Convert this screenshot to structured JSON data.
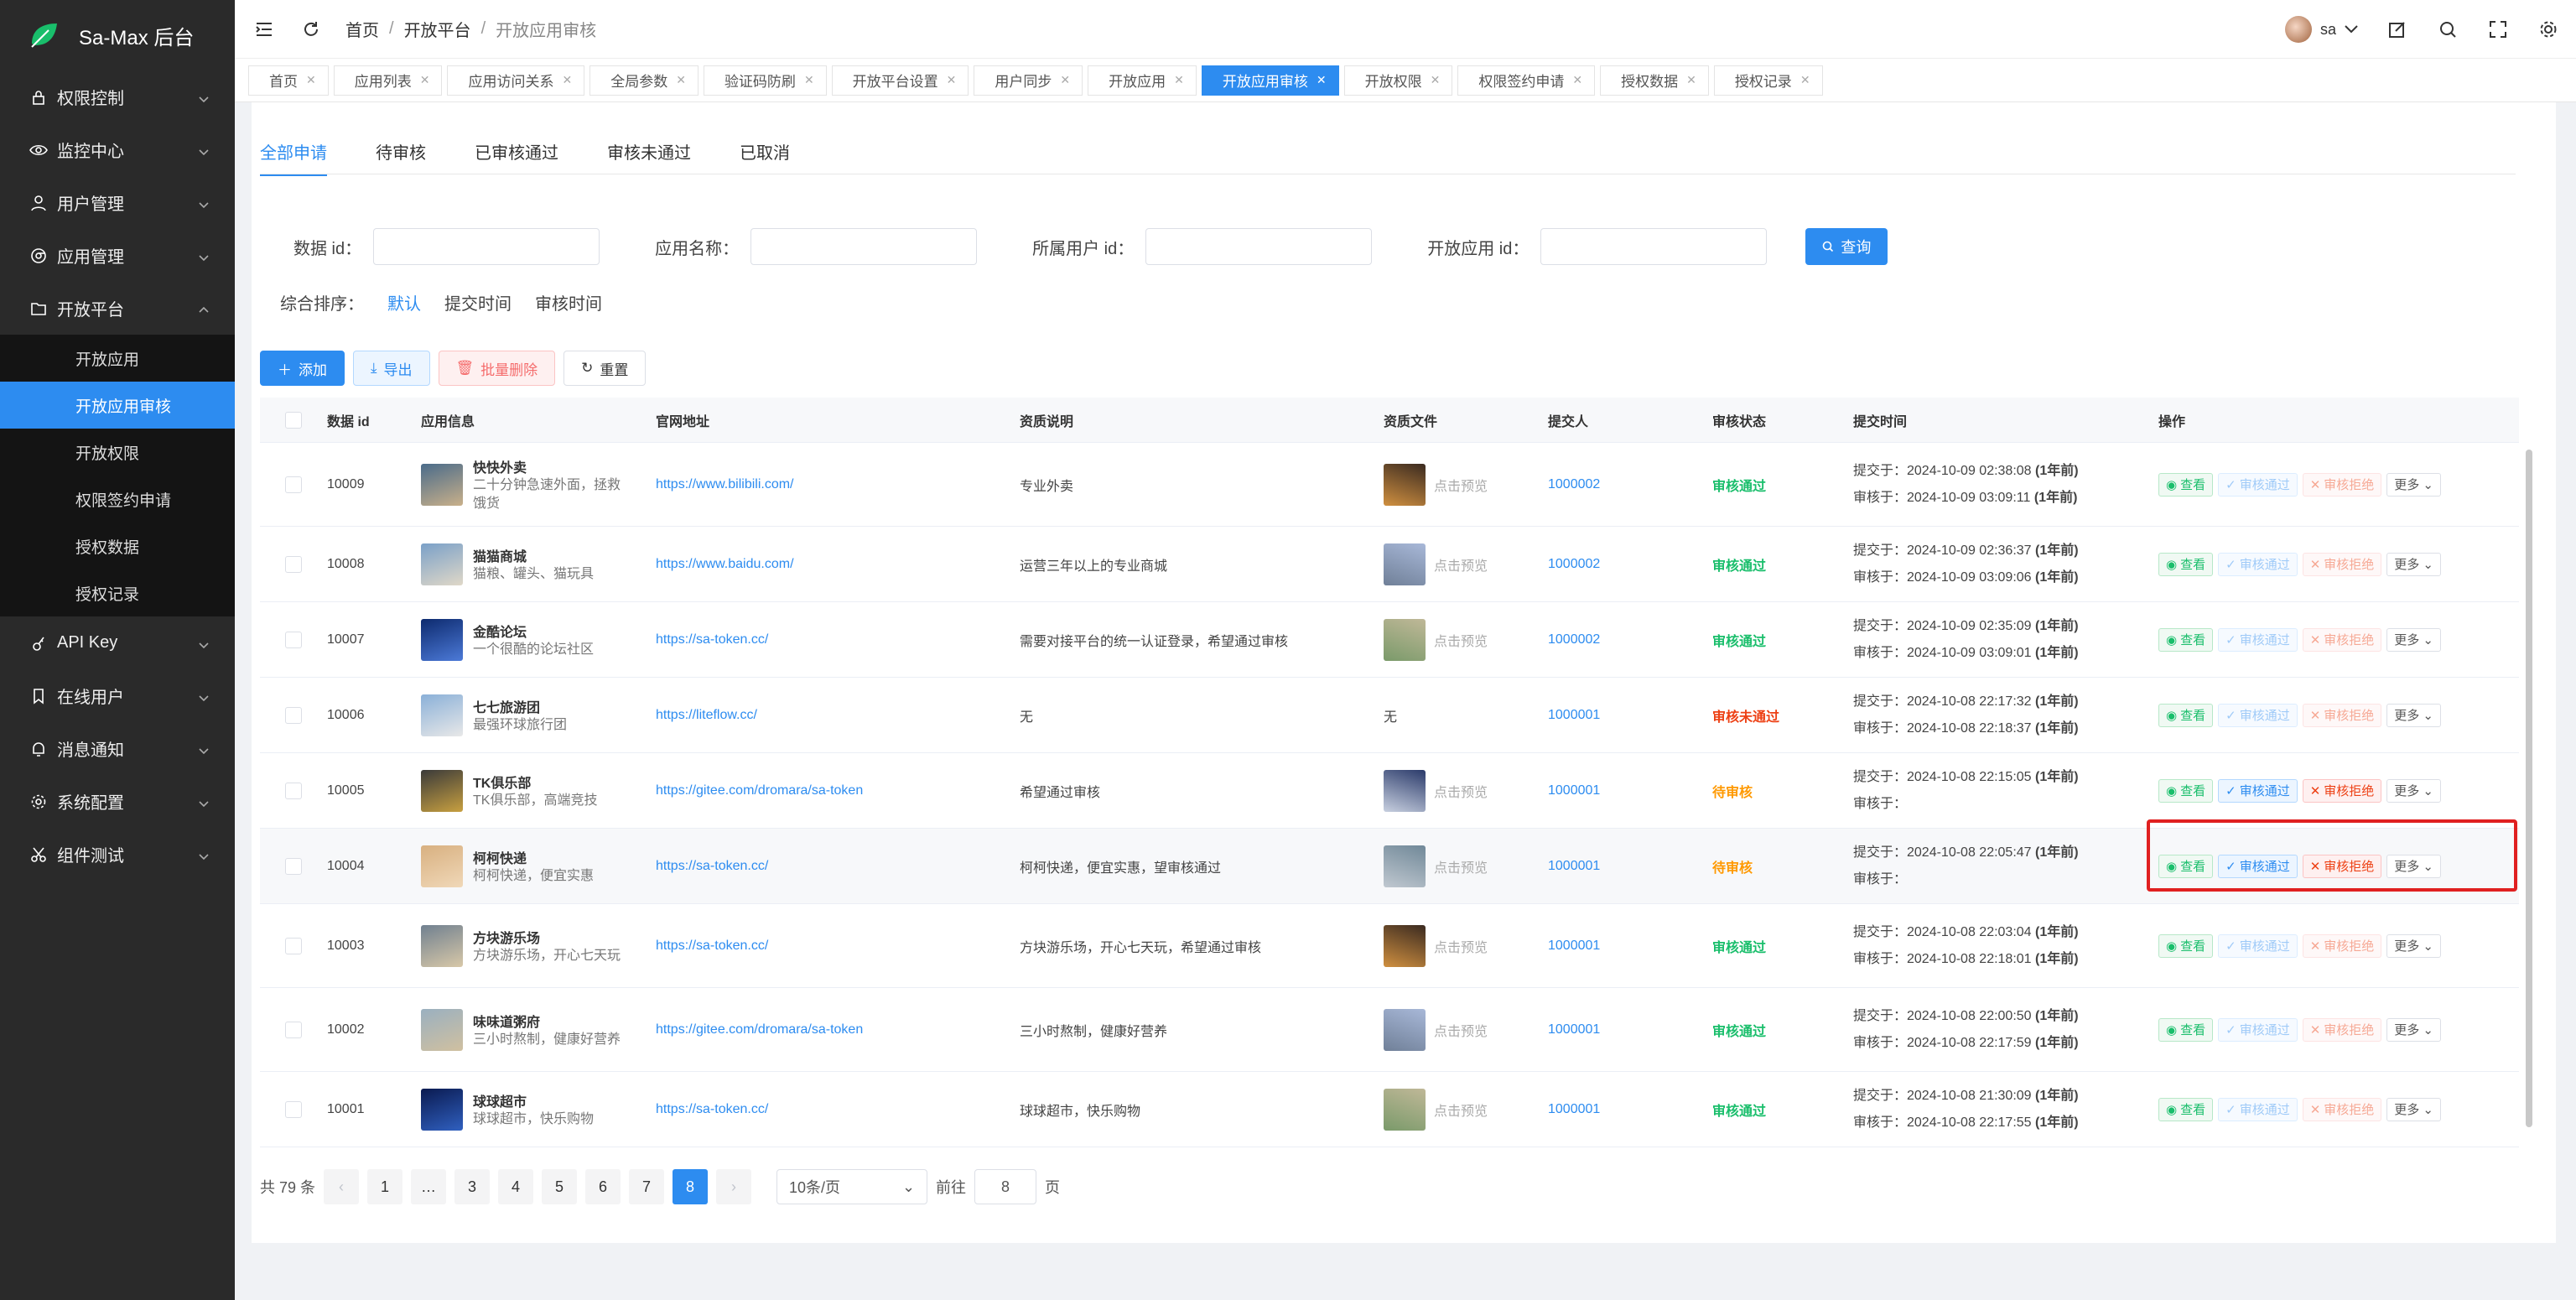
{
  "app": {
    "title": "Sa-Max 后台"
  },
  "sidebar": {
    "items": [
      {
        "label": "权限控制",
        "icon": "lock-icon"
      },
      {
        "label": "监控中心",
        "icon": "eye-icon"
      },
      {
        "label": "用户管理",
        "icon": "user-icon"
      },
      {
        "label": "应用管理",
        "icon": "chrome-icon"
      },
      {
        "label": "开放平台",
        "icon": "folder-icon"
      }
    ],
    "open_sub": [
      {
        "label": "开放应用",
        "active": false
      },
      {
        "label": "开放应用审核",
        "active": true
      },
      {
        "label": "开放权限",
        "active": false
      },
      {
        "label": "权限签约申请",
        "active": false
      },
      {
        "label": "授权数据",
        "active": false
      },
      {
        "label": "授权记录",
        "active": false
      }
    ],
    "items_after": [
      {
        "label": "API Key",
        "icon": "key-icon"
      },
      {
        "label": "在线用户",
        "icon": "bookmark-icon"
      },
      {
        "label": "消息通知",
        "icon": "bell-icon"
      },
      {
        "label": "系统配置",
        "icon": "gear-icon"
      },
      {
        "label": "组件测试",
        "icon": "scissors-icon"
      }
    ]
  },
  "header": {
    "breadcrumb": [
      "首页",
      "开放平台",
      "开放应用审核"
    ],
    "user": "sa"
  },
  "tabs": [
    "首页",
    "应用列表",
    "应用访问关系",
    "全局参数",
    "验证码防刷",
    "开放平台设置",
    "用户同步",
    "开放应用",
    "开放应用审核",
    "开放权限",
    "权限签约申请",
    "授权数据",
    "授权记录"
  ],
  "active_tab": "开放应用审核",
  "subtabs": [
    "全部申请",
    "待审核",
    "已审核通过",
    "审核未通过",
    "已取消"
  ],
  "filters": {
    "id_label": "数据 id：",
    "name_label": "应用名称：",
    "user_label": "所属用户 id：",
    "app_label": "开放应用 id：",
    "query_btn": "查询"
  },
  "sort": {
    "label": "综合排序：",
    "options": [
      "默认",
      "提交时间",
      "审核时间"
    ]
  },
  "actions": {
    "add": "添加",
    "export": "导出",
    "batch_delete": "批量删除",
    "reset": "重置"
  },
  "table": {
    "headers": [
      "数据 id",
      "应用信息",
      "官网地址",
      "资质说明",
      "资质文件",
      "提交人",
      "审核状态",
      "提交时间",
      "操作"
    ],
    "rows": [
      {
        "id": "10009",
        "name": "快快外卖",
        "desc": "二十分钟急速外面，拯救饿货",
        "url": "https://www.bilibili.com/",
        "qual": "专业外卖",
        "file": "点击预览",
        "user": "1000002",
        "status": "审核通过",
        "submit": "2024-10-09 02:38:08",
        "submit_ago": "(1年前)",
        "audit": "2024-10-09 03:09:11",
        "audit_ago": "(1年前)"
      },
      {
        "id": "10008",
        "name": "猫猫商城",
        "desc": "猫粮、罐头、猫玩具",
        "url": "https://www.baidu.com/",
        "qual": "运营三年以上的专业商城",
        "file": "点击预览",
        "user": "1000002",
        "status": "审核通过",
        "submit": "2024-10-09 02:36:37",
        "submit_ago": "(1年前)",
        "audit": "2024-10-09 03:09:06",
        "audit_ago": "(1年前)"
      },
      {
        "id": "10007",
        "name": "金酷论坛",
        "desc": "一个很酷的论坛社区",
        "url": "https://sa-token.cc/",
        "qual": "需要对接平台的统一认证登录，希望通过审核",
        "file": "点击预览",
        "user": "1000002",
        "status": "审核通过",
        "submit": "2024-10-09 02:35:09",
        "submit_ago": "(1年前)",
        "audit": "2024-10-09 03:09:01",
        "audit_ago": "(1年前)"
      },
      {
        "id": "10006",
        "name": "七七旅游团",
        "desc": "最强环球旅行团",
        "url": "https://liteflow.cc/",
        "qual": "无",
        "file": "无",
        "user": "1000001",
        "status": "审核未通过",
        "submit": "2024-10-08 22:17:32",
        "submit_ago": "(1年前)",
        "audit": "2024-10-08 22:18:37",
        "audit_ago": "(1年前)"
      },
      {
        "id": "10005",
        "name": "TK俱乐部",
        "desc": "TK俱乐部，高端竞技",
        "url": "https://gitee.com/dromara/sa-token",
        "qual": "希望通过审核",
        "file": "点击预览",
        "user": "1000001",
        "status": "待审核",
        "submit": "2024-10-08 22:15:05",
        "submit_ago": "(1年前)",
        "audit": "",
        "audit_ago": ""
      },
      {
        "id": "10004",
        "name": "柯柯快递",
        "desc": "柯柯快递，便宜实惠",
        "url": "https://sa-token.cc/",
        "qual": "柯柯快递，便宜实惠，望审核通过",
        "file": "点击预览",
        "user": "1000001",
        "status": "待审核",
        "submit": "2024-10-08 22:05:47",
        "submit_ago": "(1年前)",
        "audit": "",
        "audit_ago": ""
      },
      {
        "id": "10003",
        "name": "方块游乐场",
        "desc": "方块游乐场，开心七天玩",
        "url": "https://sa-token.cc/",
        "qual": "方块游乐场，开心七天玩，希望通过审核",
        "file": "点击预览",
        "user": "1000001",
        "status": "审核通过",
        "submit": "2024-10-08 22:03:04",
        "submit_ago": "(1年前)",
        "audit": "2024-10-08 22:18:01",
        "audit_ago": "(1年前)"
      },
      {
        "id": "10002",
        "name": "味味道粥府",
        "desc": "三小时熬制，健康好营养",
        "url": "https://gitee.com/dromara/sa-token",
        "qual": "三小时熬制，健康好营养",
        "file": "点击预览",
        "user": "1000001",
        "status": "审核通过",
        "submit": "2024-10-08 22:00:50",
        "submit_ago": "(1年前)",
        "audit": "2024-10-08 22:17:59",
        "audit_ago": "(1年前)"
      },
      {
        "id": "10001",
        "name": "球球超市",
        "desc": "球球超市，快乐购物",
        "url": "https://sa-token.cc/",
        "qual": "球球超市，快乐购物",
        "file": "点击预览",
        "user": "1000001",
        "status": "审核通过",
        "submit": "2024-10-08 21:30:09",
        "submit_ago": "(1年前)",
        "audit": "2024-10-08 22:17:55",
        "audit_ago": "(1年前)"
      }
    ],
    "submit_prefix": "提交于：",
    "audit_prefix": "审核于：",
    "op_view": "查看",
    "op_pass": "审核通过",
    "op_reject": "审核拒绝",
    "op_more": "更多"
  },
  "pager": {
    "total": "共 79 条",
    "pages": [
      "1",
      "…",
      "3",
      "4",
      "5",
      "6",
      "7",
      "8"
    ],
    "current": "8",
    "size": "10条/页",
    "goto_label": "前往",
    "goto_value": "8",
    "page_suffix": "页"
  },
  "colors": {
    "accent": "#2d8cf0",
    "success": "#19be6b",
    "danger": "#ed4014",
    "warning": "#ff9900",
    "highlight_box": "#e02020"
  }
}
